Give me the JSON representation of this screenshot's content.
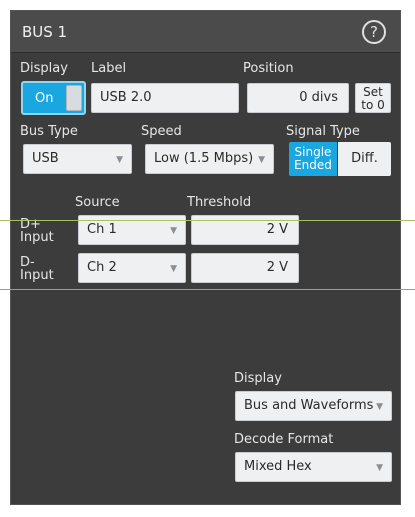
{
  "header": {
    "title": "BUS 1",
    "help_glyph": "?"
  },
  "display_toggle": {
    "label": "Display",
    "value": "On"
  },
  "label_field": {
    "label": "Label",
    "value": "USB 2.0"
  },
  "position": {
    "label": "Position",
    "value": "0 divs",
    "set_button": [
      "Set",
      "to 0"
    ]
  },
  "bus_type": {
    "label": "Bus Type",
    "value": "USB"
  },
  "speed": {
    "label": "Speed",
    "value": "Low (1.5 Mbps)"
  },
  "signal_type": {
    "label": "Signal Type",
    "selected": [
      "Single",
      "Ended"
    ],
    "other": "Diff."
  },
  "columns": {
    "source": "Source",
    "threshold": "Threshold"
  },
  "inputs": [
    {
      "label": [
        "D+",
        "Input"
      ],
      "source": "Ch 1",
      "threshold": "2 V"
    },
    {
      "label": [
        "D-",
        "Input"
      ],
      "source": "Ch 2",
      "threshold": "2 V"
    }
  ],
  "display_mode": {
    "label": "Display",
    "value": "Bus and Waveforms"
  },
  "decode_format": {
    "label": "Decode Format",
    "value": "Mixed Hex"
  },
  "colors": {
    "accent": "#1aa7e0",
    "panel": "#3c3c3c",
    "header": "#4b4b4b",
    "field": "#eef0f2"
  }
}
